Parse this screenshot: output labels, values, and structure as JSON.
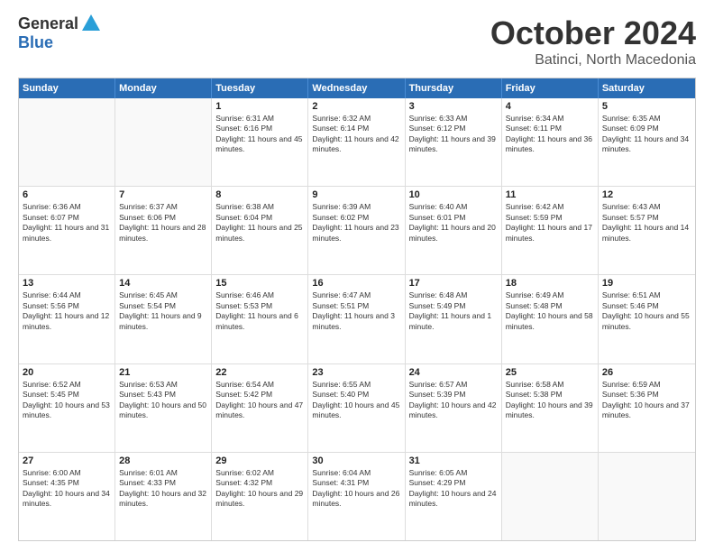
{
  "header": {
    "logo_general": "General",
    "logo_blue": "Blue",
    "title": "October 2024",
    "location": "Batinci, North Macedonia"
  },
  "weekdays": [
    "Sunday",
    "Monday",
    "Tuesday",
    "Wednesday",
    "Thursday",
    "Friday",
    "Saturday"
  ],
  "rows": [
    [
      {
        "day": "",
        "sunrise": "",
        "sunset": "",
        "daylight": "",
        "empty": true
      },
      {
        "day": "",
        "sunrise": "",
        "sunset": "",
        "daylight": "",
        "empty": true
      },
      {
        "day": "1",
        "sunrise": "Sunrise: 6:31 AM",
        "sunset": "Sunset: 6:16 PM",
        "daylight": "Daylight: 11 hours and 45 minutes."
      },
      {
        "day": "2",
        "sunrise": "Sunrise: 6:32 AM",
        "sunset": "Sunset: 6:14 PM",
        "daylight": "Daylight: 11 hours and 42 minutes."
      },
      {
        "day": "3",
        "sunrise": "Sunrise: 6:33 AM",
        "sunset": "Sunset: 6:12 PM",
        "daylight": "Daylight: 11 hours and 39 minutes."
      },
      {
        "day": "4",
        "sunrise": "Sunrise: 6:34 AM",
        "sunset": "Sunset: 6:11 PM",
        "daylight": "Daylight: 11 hours and 36 minutes."
      },
      {
        "day": "5",
        "sunrise": "Sunrise: 6:35 AM",
        "sunset": "Sunset: 6:09 PM",
        "daylight": "Daylight: 11 hours and 34 minutes."
      }
    ],
    [
      {
        "day": "6",
        "sunrise": "Sunrise: 6:36 AM",
        "sunset": "Sunset: 6:07 PM",
        "daylight": "Daylight: 11 hours and 31 minutes."
      },
      {
        "day": "7",
        "sunrise": "Sunrise: 6:37 AM",
        "sunset": "Sunset: 6:06 PM",
        "daylight": "Daylight: 11 hours and 28 minutes."
      },
      {
        "day": "8",
        "sunrise": "Sunrise: 6:38 AM",
        "sunset": "Sunset: 6:04 PM",
        "daylight": "Daylight: 11 hours and 25 minutes."
      },
      {
        "day": "9",
        "sunrise": "Sunrise: 6:39 AM",
        "sunset": "Sunset: 6:02 PM",
        "daylight": "Daylight: 11 hours and 23 minutes."
      },
      {
        "day": "10",
        "sunrise": "Sunrise: 6:40 AM",
        "sunset": "Sunset: 6:01 PM",
        "daylight": "Daylight: 11 hours and 20 minutes."
      },
      {
        "day": "11",
        "sunrise": "Sunrise: 6:42 AM",
        "sunset": "Sunset: 5:59 PM",
        "daylight": "Daylight: 11 hours and 17 minutes."
      },
      {
        "day": "12",
        "sunrise": "Sunrise: 6:43 AM",
        "sunset": "Sunset: 5:57 PM",
        "daylight": "Daylight: 11 hours and 14 minutes."
      }
    ],
    [
      {
        "day": "13",
        "sunrise": "Sunrise: 6:44 AM",
        "sunset": "Sunset: 5:56 PM",
        "daylight": "Daylight: 11 hours and 12 minutes."
      },
      {
        "day": "14",
        "sunrise": "Sunrise: 6:45 AM",
        "sunset": "Sunset: 5:54 PM",
        "daylight": "Daylight: 11 hours and 9 minutes."
      },
      {
        "day": "15",
        "sunrise": "Sunrise: 6:46 AM",
        "sunset": "Sunset: 5:53 PM",
        "daylight": "Daylight: 11 hours and 6 minutes."
      },
      {
        "day": "16",
        "sunrise": "Sunrise: 6:47 AM",
        "sunset": "Sunset: 5:51 PM",
        "daylight": "Daylight: 11 hours and 3 minutes."
      },
      {
        "day": "17",
        "sunrise": "Sunrise: 6:48 AM",
        "sunset": "Sunset: 5:49 PM",
        "daylight": "Daylight: 11 hours and 1 minute."
      },
      {
        "day": "18",
        "sunrise": "Sunrise: 6:49 AM",
        "sunset": "Sunset: 5:48 PM",
        "daylight": "Daylight: 10 hours and 58 minutes."
      },
      {
        "day": "19",
        "sunrise": "Sunrise: 6:51 AM",
        "sunset": "Sunset: 5:46 PM",
        "daylight": "Daylight: 10 hours and 55 minutes."
      }
    ],
    [
      {
        "day": "20",
        "sunrise": "Sunrise: 6:52 AM",
        "sunset": "Sunset: 5:45 PM",
        "daylight": "Daylight: 10 hours and 53 minutes."
      },
      {
        "day": "21",
        "sunrise": "Sunrise: 6:53 AM",
        "sunset": "Sunset: 5:43 PM",
        "daylight": "Daylight: 10 hours and 50 minutes."
      },
      {
        "day": "22",
        "sunrise": "Sunrise: 6:54 AM",
        "sunset": "Sunset: 5:42 PM",
        "daylight": "Daylight: 10 hours and 47 minutes."
      },
      {
        "day": "23",
        "sunrise": "Sunrise: 6:55 AM",
        "sunset": "Sunset: 5:40 PM",
        "daylight": "Daylight: 10 hours and 45 minutes."
      },
      {
        "day": "24",
        "sunrise": "Sunrise: 6:57 AM",
        "sunset": "Sunset: 5:39 PM",
        "daylight": "Daylight: 10 hours and 42 minutes."
      },
      {
        "day": "25",
        "sunrise": "Sunrise: 6:58 AM",
        "sunset": "Sunset: 5:38 PM",
        "daylight": "Daylight: 10 hours and 39 minutes."
      },
      {
        "day": "26",
        "sunrise": "Sunrise: 6:59 AM",
        "sunset": "Sunset: 5:36 PM",
        "daylight": "Daylight: 10 hours and 37 minutes."
      }
    ],
    [
      {
        "day": "27",
        "sunrise": "Sunrise: 6:00 AM",
        "sunset": "Sunset: 4:35 PM",
        "daylight": "Daylight: 10 hours and 34 minutes."
      },
      {
        "day": "28",
        "sunrise": "Sunrise: 6:01 AM",
        "sunset": "Sunset: 4:33 PM",
        "daylight": "Daylight: 10 hours and 32 minutes."
      },
      {
        "day": "29",
        "sunrise": "Sunrise: 6:02 AM",
        "sunset": "Sunset: 4:32 PM",
        "daylight": "Daylight: 10 hours and 29 minutes."
      },
      {
        "day": "30",
        "sunrise": "Sunrise: 6:04 AM",
        "sunset": "Sunset: 4:31 PM",
        "daylight": "Daylight: 10 hours and 26 minutes."
      },
      {
        "day": "31",
        "sunrise": "Sunrise: 6:05 AM",
        "sunset": "Sunset: 4:29 PM",
        "daylight": "Daylight: 10 hours and 24 minutes."
      },
      {
        "day": "",
        "sunrise": "",
        "sunset": "",
        "daylight": "",
        "empty": true
      },
      {
        "day": "",
        "sunrise": "",
        "sunset": "",
        "daylight": "",
        "empty": true
      }
    ]
  ]
}
